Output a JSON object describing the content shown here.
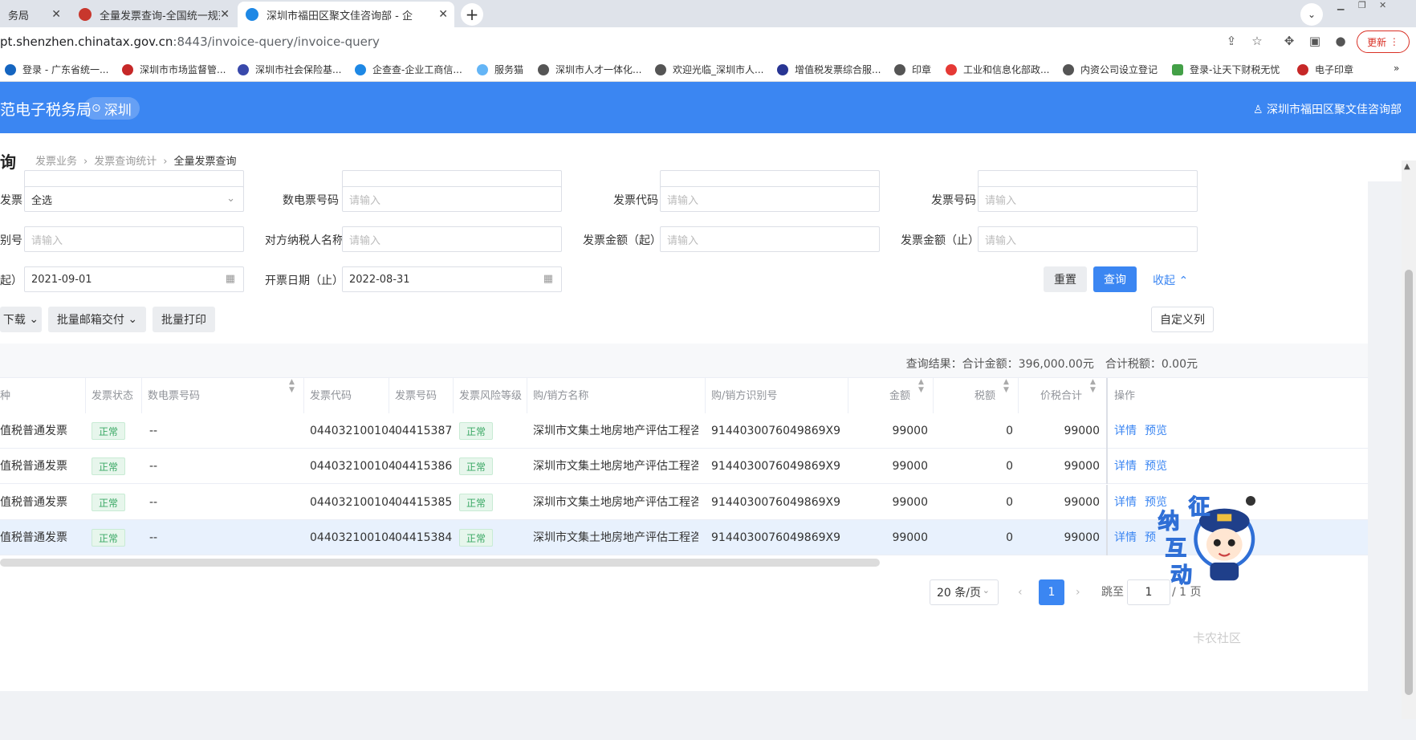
{
  "browser": {
    "tabs": [
      {
        "label": "务局",
        "active": false
      },
      {
        "label": "全量发票查询-全国统一规范电子",
        "active": false
      },
      {
        "label": "深圳市福田区聚文佳咨询部 - 企",
        "active": true
      }
    ],
    "url_host": "pt.shenzhen.chinatax.gov.cn",
    "url_path": ":8443/invoice-query/invoice-query",
    "update_label": "更新",
    "bookmarks": [
      "登录 - 广东省统一...",
      "深圳市市场监督管...",
      "深圳市社会保险基...",
      "企查查-企业工商信...",
      "服务猫",
      "深圳市人才一体化...",
      "欢迎光临_深圳市人...",
      "增值税发票综合服...",
      "印章",
      "工业和信息化部政...",
      "内资公司设立登记",
      "登录-让天下财税无忧",
      "电子印章"
    ],
    "more_label": "»"
  },
  "header": {
    "title": "范电子税务局",
    "city": "深圳",
    "user": "深圳市福田区聚文佳咨询部"
  },
  "page": {
    "title": "询",
    "breadcrumbs": [
      "发票业务",
      "发票查询统计",
      "全量发票查询"
    ]
  },
  "filters": {
    "row1": {
      "invoice_type_label": "发票",
      "invoice_type_value": "全选",
      "e_invoice_no_label": "数电票号码",
      "e_invoice_no_placeholder": "请输入",
      "invoice_code_label": "发票代码",
      "invoice_code_placeholder": "请输入",
      "invoice_no_label": "发票号码",
      "invoice_no_placeholder": "请输入"
    },
    "row2": {
      "id_label": "别号",
      "id_placeholder": "请输入",
      "party_name_label": "对方纳税人名称",
      "party_name_placeholder": "请输入",
      "amount_from_label": "发票金额（起）",
      "amount_from_placeholder": "请输入",
      "amount_to_label": "发票金额（止）",
      "amount_to_placeholder": "请输入"
    },
    "row3": {
      "date_from_label": "起）",
      "date_from_value": "2021-09-01",
      "date_to_label": "开票日期（止）",
      "date_to_value": "2022-08-31"
    },
    "reset_label": "重置",
    "query_label": "查询",
    "collapse_label": "收起"
  },
  "actions": {
    "download_label": "下载",
    "batch_email_label": "批量邮箱交付",
    "batch_print_label": "批量打印",
    "custom_columns_label": "自定义列"
  },
  "summary": {
    "text": "查询结果：合计金额：396,000.00元　合计税额：0.00元"
  },
  "table": {
    "columns": {
      "type": "种",
      "status": "发票状态",
      "e_no": "数电票号码",
      "code": "发票代码",
      "number": "发票号码",
      "risk": "发票风险等级",
      "party": "购/销方名称",
      "party_id": "购/销方识别号",
      "amount": "金额",
      "tax": "税额",
      "total": "价税合计",
      "ops": "操作"
    },
    "rows": [
      {
        "type": "值税普通发票",
        "status": "正常",
        "e_no": "--",
        "code": "044032100104",
        "number": "04415387",
        "risk": "正常",
        "party": "深圳市文集土地房地产评估工程咨...",
        "party_id": "9144030076049869X9",
        "amount": "99000",
        "tax": "0",
        "total": "99000",
        "detail": "详情",
        "preview": "预览"
      },
      {
        "type": "值税普通发票",
        "status": "正常",
        "e_no": "--",
        "code": "044032100104",
        "number": "04415386",
        "risk": "正常",
        "party": "深圳市文集土地房地产评估工程咨...",
        "party_id": "9144030076049869X9",
        "amount": "99000",
        "tax": "0",
        "total": "99000",
        "detail": "详情",
        "preview": "预览"
      },
      {
        "type": "值税普通发票",
        "status": "正常",
        "e_no": "--",
        "code": "044032100104",
        "number": "04415385",
        "risk": "正常",
        "party": "深圳市文集土地房地产评估工程咨...",
        "party_id": "9144030076049869X9",
        "amount": "99000",
        "tax": "0",
        "total": "99000",
        "detail": "详情",
        "preview": "预览"
      },
      {
        "type": "值税普通发票",
        "status": "正常",
        "e_no": "--",
        "code": "044032100104",
        "number": "04415384",
        "risk": "正常",
        "party": "深圳市文集土地房地产评估工程咨...",
        "party_id": "9144030076049869X9",
        "amount": "99000",
        "tax": "0",
        "total": "99000",
        "detail": "详情",
        "preview": "预"
      }
    ]
  },
  "pagination": {
    "page_size": "20 条/页",
    "current_page": "1",
    "jump_label": "跳至",
    "jump_value": "1",
    "total_label": "/ 1 页"
  },
  "mascot": {
    "text": [
      "征",
      "纳",
      "互",
      "动"
    ]
  },
  "watermark": "卡农社区",
  "colors": {
    "primary": "#3b86f2",
    "status_green": "#3aa864"
  }
}
